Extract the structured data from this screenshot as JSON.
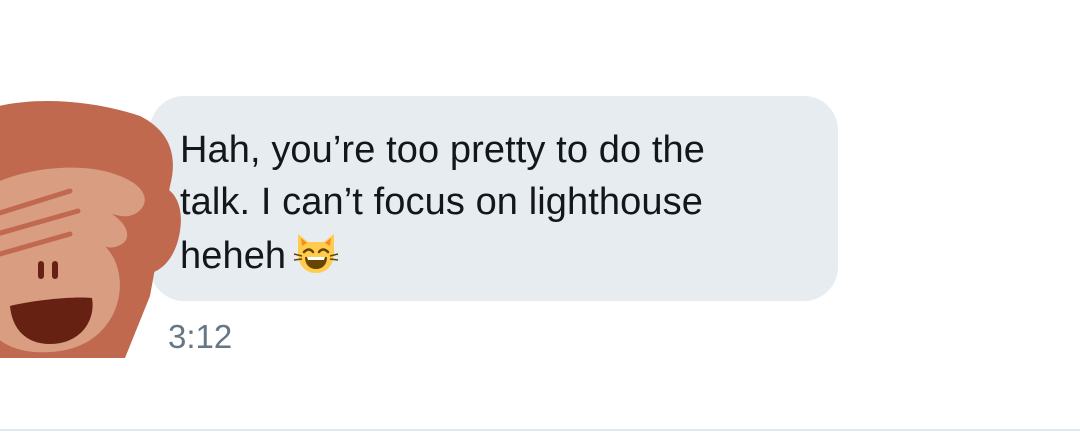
{
  "message": {
    "lines": [
      "Hah, you’re too pretty to do the",
      "talk. I can’t focus on lighthouse",
      "heheh"
    ],
    "emoji_icon": "smiling-cat-with-closed-eyes-emoji",
    "timestamp": "3:12"
  },
  "avatar": {
    "icon": "see-no-evil-monkey-emoji"
  },
  "colors": {
    "bubble": "#e6ecf0",
    "text": "#14171a",
    "timestamp": "#657786",
    "divider": "#e1e8ed"
  }
}
